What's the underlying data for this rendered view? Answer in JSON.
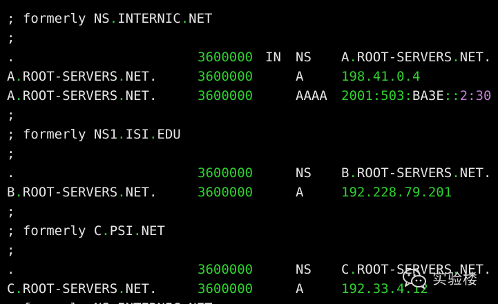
{
  "terminal": {
    "lines": [
      {
        "kind": "comment",
        "text": "; formerly NS.INTERNIC.NET"
      },
      {
        "kind": "comment",
        "text": ";"
      },
      {
        "kind": "record",
        "name": ".",
        "ttl": "3600000",
        "class": "IN",
        "type": "NS",
        "data": "A.ROOT-SERVERS.NET."
      },
      {
        "kind": "record",
        "name": "A.ROOT-SERVERS.NET.",
        "ttl": "3600000",
        "class": "",
        "type": "A",
        "data": "198.41.0.4"
      },
      {
        "kind": "record",
        "name": "A.ROOT-SERVERS.NET.",
        "ttl": "3600000",
        "class": "",
        "type": "AAAA",
        "data": "2001:503:BA3E::2:30"
      },
      {
        "kind": "comment",
        "text": ";"
      },
      {
        "kind": "comment",
        "text": "; formerly NS1.ISI.EDU"
      },
      {
        "kind": "comment",
        "text": ";"
      },
      {
        "kind": "record",
        "name": ".",
        "ttl": "3600000",
        "class": "",
        "type": "NS",
        "data": "B.ROOT-SERVERS.NET."
      },
      {
        "kind": "record",
        "name": "B.ROOT-SERVERS.NET.",
        "ttl": "3600000",
        "class": "",
        "type": "A",
        "data": "192.228.79.201"
      },
      {
        "kind": "comment",
        "text": ";"
      },
      {
        "kind": "comment",
        "text": "; formerly C.PSI.NET"
      },
      {
        "kind": "comment",
        "text": ";"
      },
      {
        "kind": "record",
        "name": ".",
        "ttl": "3600000",
        "class": "",
        "type": "NS",
        "data": "C.ROOT-SERVERS.NET."
      },
      {
        "kind": "record",
        "name": "C.ROOT-SERVERS.NET.",
        "ttl": "3600000",
        "class": "",
        "type": "A",
        "data": "192.33.4.12"
      },
      {
        "kind": "comment",
        "text": "; formerly NS.INTERNIC.NET"
      }
    ]
  },
  "watermark": {
    "text": "实验楼",
    "icon": "wechat-icon"
  },
  "colors": {
    "background": "#000000",
    "text": "#e6e6e6",
    "highlight_green": "#2fd12f",
    "highlight_purple": "#c080d0"
  }
}
